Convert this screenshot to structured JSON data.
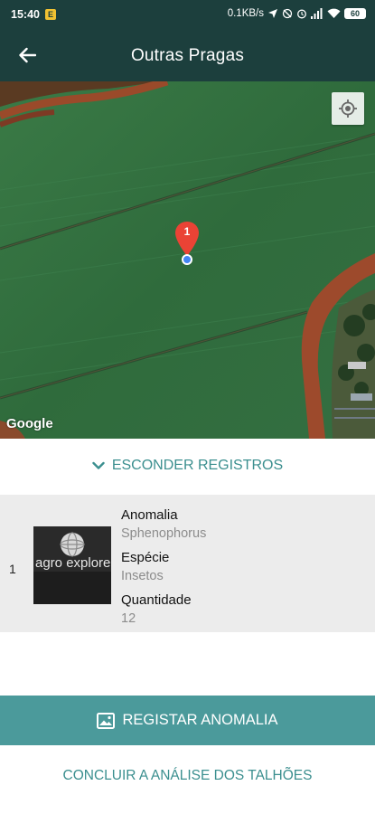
{
  "status_bar": {
    "time": "15:40",
    "app_icon_letter": "E",
    "network_speed": "0.1KB/s",
    "battery": "60"
  },
  "app_bar": {
    "title": "Outras Pragas"
  },
  "map": {
    "marker_label": "1",
    "attribution": "Google"
  },
  "records_toggle": {
    "label": "ESCONDER REGISTROS"
  },
  "records": [
    {
      "index": "1",
      "thumbnail_text": "agro explorer",
      "anomaly_label": "Anomalia",
      "anomaly_value": "Sphenophorus",
      "species_label": "Espécie",
      "species_value": "Insetos",
      "quantity_label": "Quantidade",
      "quantity_value": "12"
    }
  ],
  "actions": {
    "register_label": "REGISTAR ANOMALIA",
    "conclude_label": "CONCLUIR A ANÁLISE DOS TALHÕES"
  },
  "colors": {
    "header": "#1c3f3d",
    "accent": "#4b9a9b",
    "accent_text": "#3b8f8f",
    "marker": "#ea4335",
    "location": "#4285f4"
  }
}
